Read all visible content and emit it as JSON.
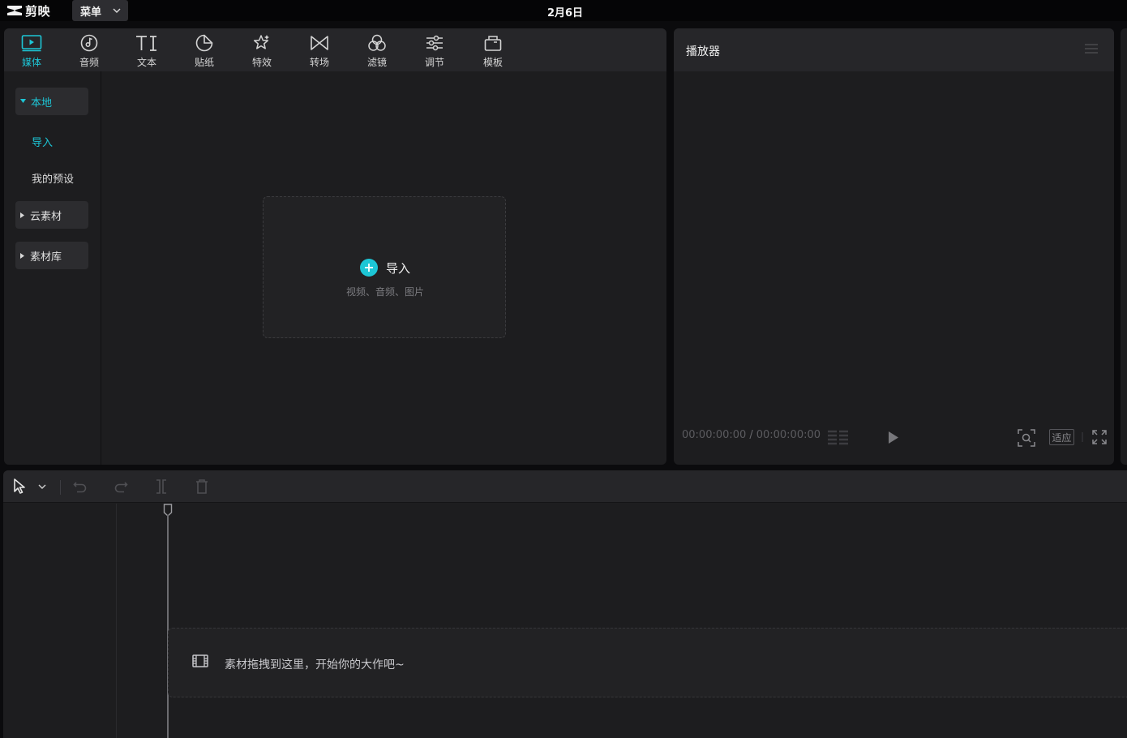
{
  "app": {
    "name": "剪映",
    "menu_label": "菜单",
    "window_title": "2月6日"
  },
  "media_toolbar": {
    "tools": [
      {
        "label": "媒体",
        "icon": "media-icon",
        "active": true
      },
      {
        "label": "音频",
        "icon": "audio-icon",
        "active": false
      },
      {
        "label": "文本",
        "icon": "text-icon",
        "active": false
      },
      {
        "label": "贴纸",
        "icon": "sticker-icon",
        "active": false
      },
      {
        "label": "特效",
        "icon": "effects-icon",
        "active": false
      },
      {
        "label": "转场",
        "icon": "transition-icon",
        "active": false
      },
      {
        "label": "滤镜",
        "icon": "filter-icon",
        "active": false
      },
      {
        "label": "调节",
        "icon": "adjust-icon",
        "active": false
      },
      {
        "label": "模板",
        "icon": "template-icon",
        "active": false
      }
    ]
  },
  "sidebar": {
    "local": "本地",
    "local_items": [
      "导入",
      "我的预设"
    ],
    "cloud": "云素材",
    "library": "素材库"
  },
  "import_box": {
    "label": "导入",
    "hint": "视频、音频、图片"
  },
  "player": {
    "title": "播放器",
    "current_time": "00:00:00:00",
    "separator": "/",
    "total_time": "00:00:00:00",
    "fit_label": "适应"
  },
  "timeline": {
    "drop_hint": "素材拖拽到这里，开始你的大作吧~"
  },
  "colors": {
    "accent": "#1dc6d6",
    "panel_bg": "#1d1d1f",
    "toolbar_bg": "#262629",
    "app_bg": "#0b0b0d"
  }
}
